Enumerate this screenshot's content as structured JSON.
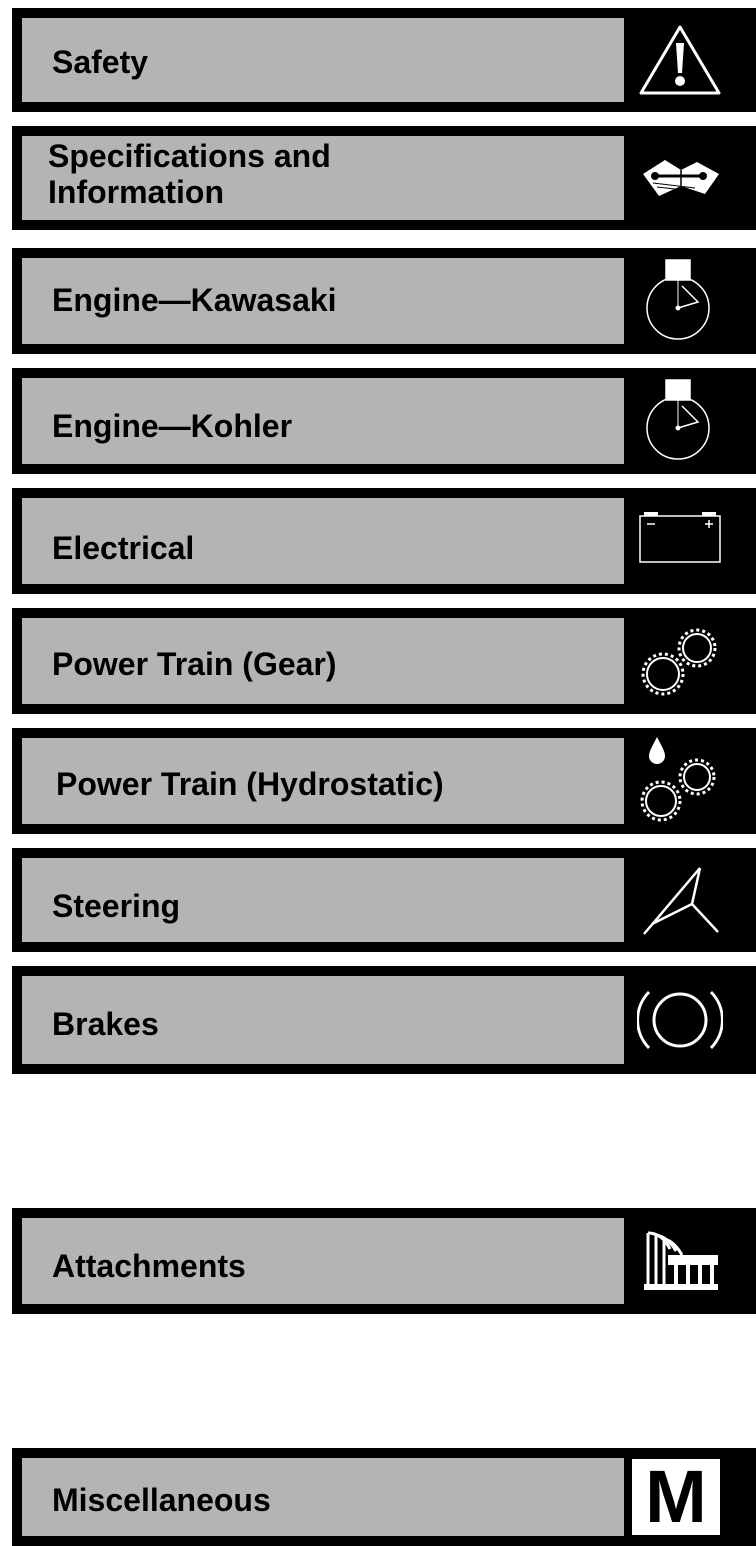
{
  "sections": [
    {
      "id": "safety",
      "label": "Safety",
      "icon": "warning-triangle-icon"
    },
    {
      "id": "specifications",
      "label": "Specifications and\nInformation",
      "icon": "manual-wrench-icon"
    },
    {
      "id": "engine-kawasaki",
      "label": "Engine—Kawasaki",
      "icon": "engine-gauge-icon"
    },
    {
      "id": "engine-kohler",
      "label": "Engine—Kohler",
      "icon": "engine-gauge-icon"
    },
    {
      "id": "electrical",
      "label": "Electrical",
      "icon": "battery-icon"
    },
    {
      "id": "power-train-gear",
      "label": "Power Train (Gear)",
      "icon": "gears-icon"
    },
    {
      "id": "power-train-hydrostatic",
      "label": "Power Train (Hydrostatic)",
      "icon": "gears-oil-drop-icon"
    },
    {
      "id": "steering",
      "label": "Steering",
      "icon": "steering-icon"
    },
    {
      "id": "brakes",
      "label": "Brakes",
      "icon": "brake-icon"
    },
    {
      "id": "attachments",
      "label": "Attachments",
      "icon": "attachment-icon"
    },
    {
      "id": "miscellaneous",
      "label": "Miscellaneous",
      "icon": "letter-m-icon",
      "icon_text": "M"
    }
  ]
}
